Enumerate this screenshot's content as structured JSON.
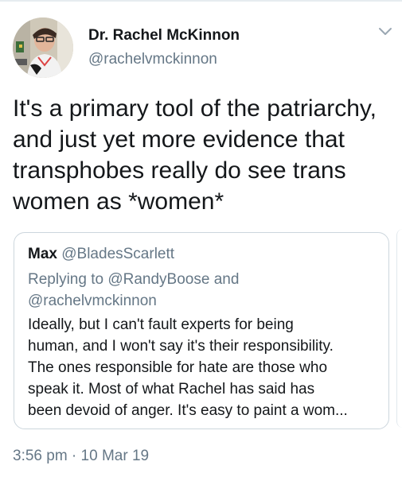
{
  "tweet": {
    "display_name": "Dr. Rachel McKinnon",
    "handle": "@rachelvmckinnon",
    "text_lines": [
      "It's a primary tool of the patriarchy,",
      "and just yet more evidence that",
      "transphobes really do see trans",
      "women as *women*"
    ],
    "timestamp": "3:56 pm · 10 Mar 19"
  },
  "quoted_tweet": {
    "name": "Max",
    "handle": "@BladesScarlett",
    "replying_lines": [
      "Replying to @RandyBoose and",
      "@rachelvmckinnon"
    ],
    "body_lines": [
      "Ideally, but I can't fault experts for being",
      "human, and I won't say it's their responsibility.",
      "The ones responsible for hate are those who",
      "speak it. Most of what Rachel has said has",
      "been devoid of anger. It's easy to paint a wom..."
    ]
  },
  "icons": {
    "caret": "chevron-down-icon",
    "avatar": "profile-photo"
  },
  "colors": {
    "primary_text": "#14171a",
    "secondary_text": "#657786",
    "border": "#ccd6dd"
  }
}
